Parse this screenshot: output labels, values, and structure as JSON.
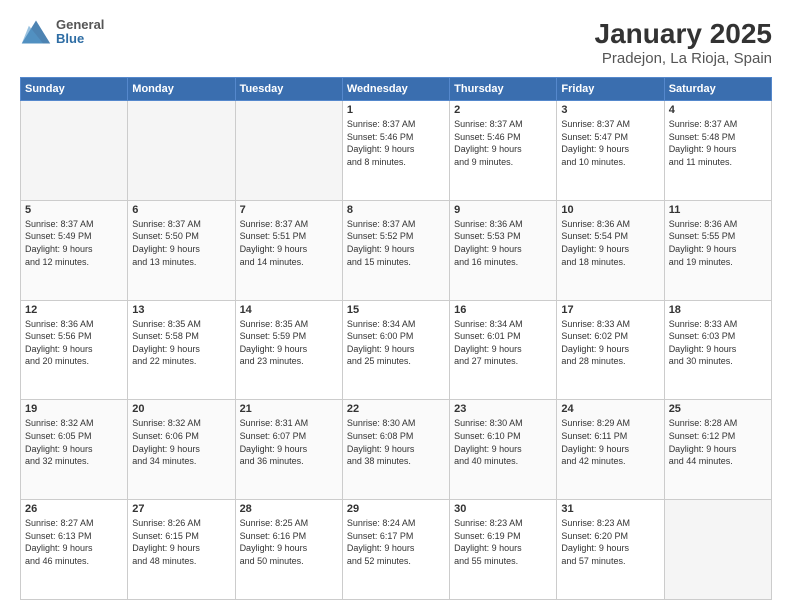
{
  "header": {
    "logo_line1": "General",
    "logo_line2": "Blue",
    "title": "January 2025",
    "subtitle": "Pradejon, La Rioja, Spain"
  },
  "weekdays": [
    "Sunday",
    "Monday",
    "Tuesday",
    "Wednesday",
    "Thursday",
    "Friday",
    "Saturday"
  ],
  "weeks": [
    [
      {
        "day": "",
        "info": ""
      },
      {
        "day": "",
        "info": ""
      },
      {
        "day": "",
        "info": ""
      },
      {
        "day": "1",
        "info": "Sunrise: 8:37 AM\nSunset: 5:46 PM\nDaylight: 9 hours\nand 8 minutes."
      },
      {
        "day": "2",
        "info": "Sunrise: 8:37 AM\nSunset: 5:46 PM\nDaylight: 9 hours\nand 9 minutes."
      },
      {
        "day": "3",
        "info": "Sunrise: 8:37 AM\nSunset: 5:47 PM\nDaylight: 9 hours\nand 10 minutes."
      },
      {
        "day": "4",
        "info": "Sunrise: 8:37 AM\nSunset: 5:48 PM\nDaylight: 9 hours\nand 11 minutes."
      }
    ],
    [
      {
        "day": "5",
        "info": "Sunrise: 8:37 AM\nSunset: 5:49 PM\nDaylight: 9 hours\nand 12 minutes."
      },
      {
        "day": "6",
        "info": "Sunrise: 8:37 AM\nSunset: 5:50 PM\nDaylight: 9 hours\nand 13 minutes."
      },
      {
        "day": "7",
        "info": "Sunrise: 8:37 AM\nSunset: 5:51 PM\nDaylight: 9 hours\nand 14 minutes."
      },
      {
        "day": "8",
        "info": "Sunrise: 8:37 AM\nSunset: 5:52 PM\nDaylight: 9 hours\nand 15 minutes."
      },
      {
        "day": "9",
        "info": "Sunrise: 8:36 AM\nSunset: 5:53 PM\nDaylight: 9 hours\nand 16 minutes."
      },
      {
        "day": "10",
        "info": "Sunrise: 8:36 AM\nSunset: 5:54 PM\nDaylight: 9 hours\nand 18 minutes."
      },
      {
        "day": "11",
        "info": "Sunrise: 8:36 AM\nSunset: 5:55 PM\nDaylight: 9 hours\nand 19 minutes."
      }
    ],
    [
      {
        "day": "12",
        "info": "Sunrise: 8:36 AM\nSunset: 5:56 PM\nDaylight: 9 hours\nand 20 minutes."
      },
      {
        "day": "13",
        "info": "Sunrise: 8:35 AM\nSunset: 5:58 PM\nDaylight: 9 hours\nand 22 minutes."
      },
      {
        "day": "14",
        "info": "Sunrise: 8:35 AM\nSunset: 5:59 PM\nDaylight: 9 hours\nand 23 minutes."
      },
      {
        "day": "15",
        "info": "Sunrise: 8:34 AM\nSunset: 6:00 PM\nDaylight: 9 hours\nand 25 minutes."
      },
      {
        "day": "16",
        "info": "Sunrise: 8:34 AM\nSunset: 6:01 PM\nDaylight: 9 hours\nand 27 minutes."
      },
      {
        "day": "17",
        "info": "Sunrise: 8:33 AM\nSunset: 6:02 PM\nDaylight: 9 hours\nand 28 minutes."
      },
      {
        "day": "18",
        "info": "Sunrise: 8:33 AM\nSunset: 6:03 PM\nDaylight: 9 hours\nand 30 minutes."
      }
    ],
    [
      {
        "day": "19",
        "info": "Sunrise: 8:32 AM\nSunset: 6:05 PM\nDaylight: 9 hours\nand 32 minutes."
      },
      {
        "day": "20",
        "info": "Sunrise: 8:32 AM\nSunset: 6:06 PM\nDaylight: 9 hours\nand 34 minutes."
      },
      {
        "day": "21",
        "info": "Sunrise: 8:31 AM\nSunset: 6:07 PM\nDaylight: 9 hours\nand 36 minutes."
      },
      {
        "day": "22",
        "info": "Sunrise: 8:30 AM\nSunset: 6:08 PM\nDaylight: 9 hours\nand 38 minutes."
      },
      {
        "day": "23",
        "info": "Sunrise: 8:30 AM\nSunset: 6:10 PM\nDaylight: 9 hours\nand 40 minutes."
      },
      {
        "day": "24",
        "info": "Sunrise: 8:29 AM\nSunset: 6:11 PM\nDaylight: 9 hours\nand 42 minutes."
      },
      {
        "day": "25",
        "info": "Sunrise: 8:28 AM\nSunset: 6:12 PM\nDaylight: 9 hours\nand 44 minutes."
      }
    ],
    [
      {
        "day": "26",
        "info": "Sunrise: 8:27 AM\nSunset: 6:13 PM\nDaylight: 9 hours\nand 46 minutes."
      },
      {
        "day": "27",
        "info": "Sunrise: 8:26 AM\nSunset: 6:15 PM\nDaylight: 9 hours\nand 48 minutes."
      },
      {
        "day": "28",
        "info": "Sunrise: 8:25 AM\nSunset: 6:16 PM\nDaylight: 9 hours\nand 50 minutes."
      },
      {
        "day": "29",
        "info": "Sunrise: 8:24 AM\nSunset: 6:17 PM\nDaylight: 9 hours\nand 52 minutes."
      },
      {
        "day": "30",
        "info": "Sunrise: 8:23 AM\nSunset: 6:19 PM\nDaylight: 9 hours\nand 55 minutes."
      },
      {
        "day": "31",
        "info": "Sunrise: 8:23 AM\nSunset: 6:20 PM\nDaylight: 9 hours\nand 57 minutes."
      },
      {
        "day": "",
        "info": ""
      }
    ]
  ]
}
